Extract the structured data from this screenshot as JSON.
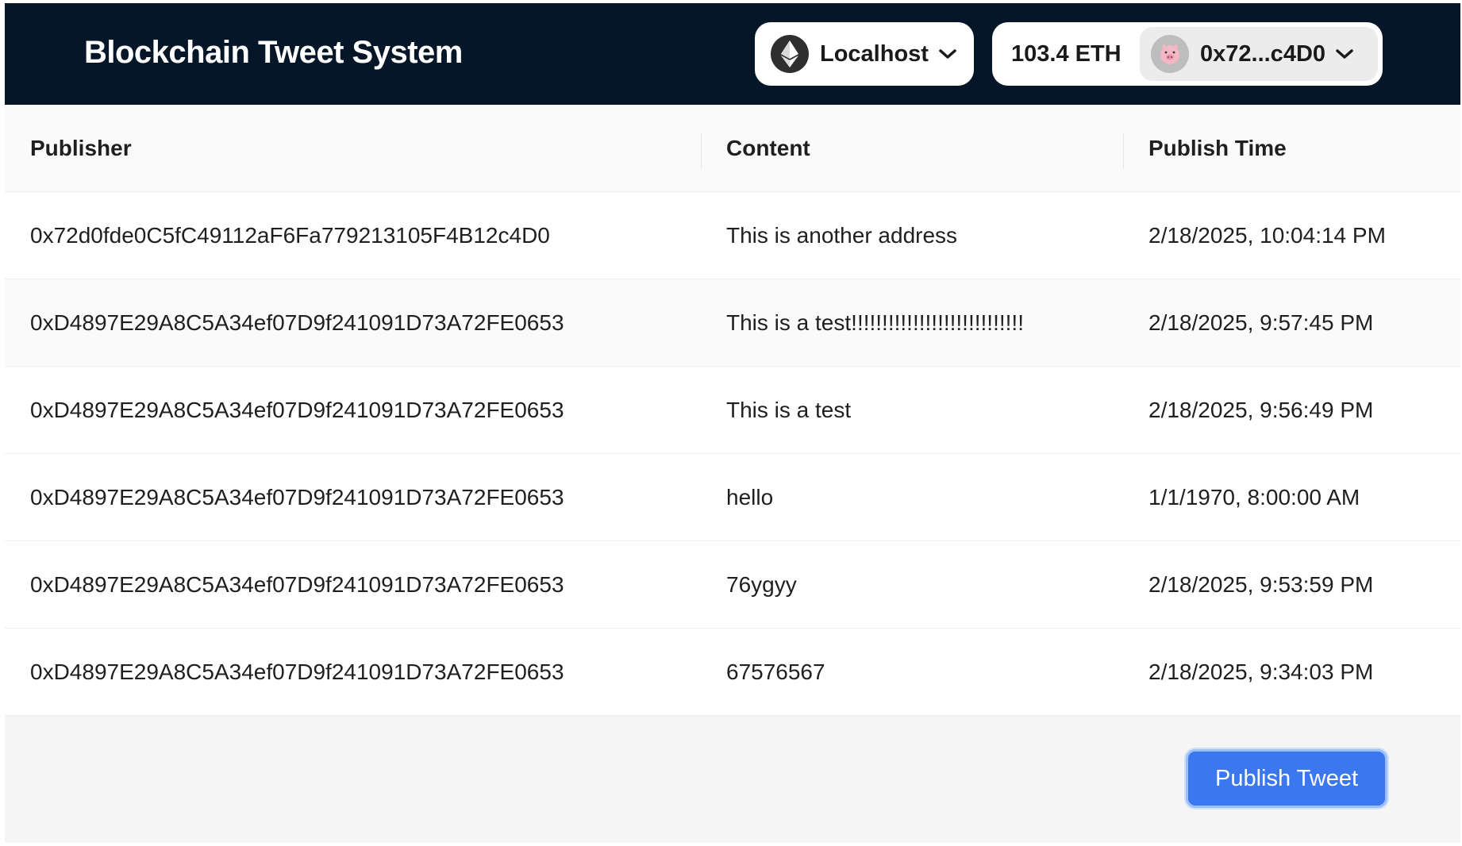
{
  "header": {
    "title": "Blockchain Tweet System",
    "network": {
      "label": "Localhost",
      "icon": "ethereum-icon"
    },
    "account": {
      "balance": "103.4 ETH",
      "address": "0x72...c4D0",
      "avatar_icon": "pig-avatar-icon"
    }
  },
  "table": {
    "columns": [
      "Publisher",
      "Content",
      "Publish Time"
    ],
    "rows": [
      {
        "publisher": "0x72d0fde0C5fC49112aF6Fa779213105F4B12c4D0",
        "content": "This is another address",
        "time": "2/18/2025, 10:04:14 PM"
      },
      {
        "publisher": "0xD4897E29A8C5A34ef07D9f241091D73A72FE0653",
        "content": "This is a test!!!!!!!!!!!!!!!!!!!!!!!!!!!!",
        "time": "2/18/2025, 9:57:45 PM"
      },
      {
        "publisher": "0xD4897E29A8C5A34ef07D9f241091D73A72FE0653",
        "content": "This is a test",
        "time": "2/18/2025, 9:56:49 PM"
      },
      {
        "publisher": "0xD4897E29A8C5A34ef07D9f241091D73A72FE0653",
        "content": "hello",
        "time": "1/1/1970, 8:00:00 AM"
      },
      {
        "publisher": "0xD4897E29A8C5A34ef07D9f241091D73A72FE0653",
        "content": "76ygyy",
        "time": "2/18/2025, 9:53:59 PM"
      },
      {
        "publisher": "0xD4897E29A8C5A34ef07D9f241091D73A72FE0653",
        "content": "67576567",
        "time": "2/18/2025, 9:34:03 PM"
      }
    ]
  },
  "footer": {
    "publish_label": "Publish Tweet"
  },
  "colors": {
    "header_bg": "#061629",
    "accent": "#3b78f0"
  }
}
